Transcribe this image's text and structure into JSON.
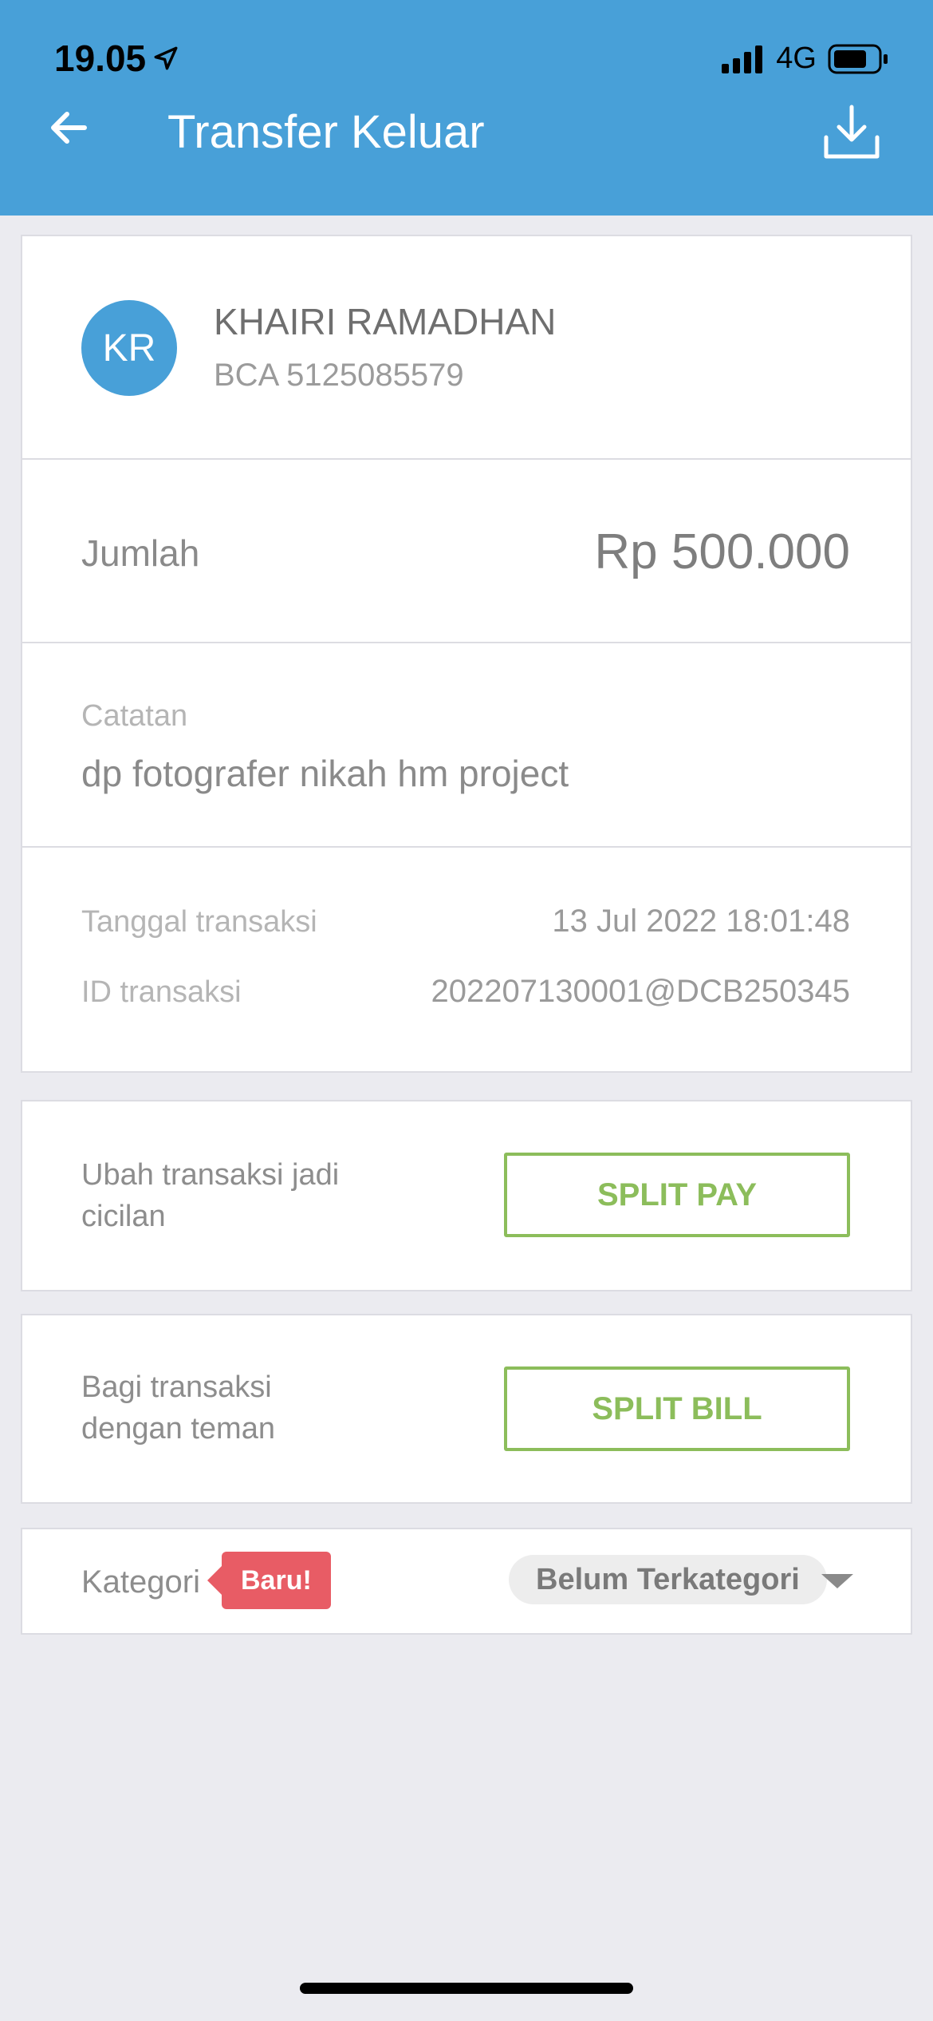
{
  "status_bar": {
    "time": "19.05",
    "network": "4G"
  },
  "header": {
    "title": "Transfer Keluar"
  },
  "recipient": {
    "initials": "KR",
    "name": "KHAIRI RAMADHAN",
    "account": "BCA 5125085579"
  },
  "amount": {
    "label": "Jumlah",
    "value": "Rp 500.000"
  },
  "note": {
    "label": "Catatan",
    "value": "dp fotografer nikah hm project"
  },
  "transaction": {
    "date_label": "Tanggal transaksi",
    "date_value": "13 Jul 2022 18:01:48",
    "id_label": "ID transaksi",
    "id_value": "202207130001@DCB250345"
  },
  "split_pay": {
    "line1": "Ubah transaksi jadi",
    "line2": "cicilan",
    "button": "SPLIT PAY"
  },
  "split_bill": {
    "line1": "Bagi transaksi",
    "line2": "dengan teman",
    "button": "SPLIT BILL"
  },
  "category": {
    "label": "Kategori",
    "badge": "Baru!",
    "value": "Belum Terkategori"
  },
  "colors": {
    "header": "#48a0d8",
    "accent_green": "#8cbd5b",
    "badge_red": "#e85c65"
  }
}
